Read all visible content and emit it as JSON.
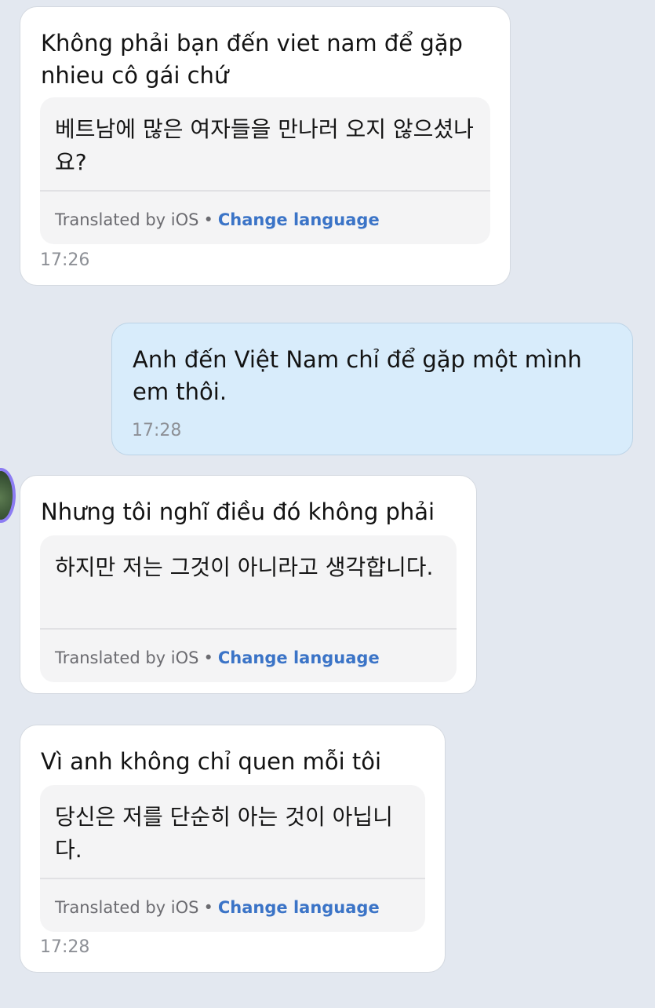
{
  "messages": [
    {
      "original": "Không phải bạn đến viet nam để gặp nhieu cô gái chứ",
      "translation": "베트남에 많은 여자들을 만나러 오지 않으셨나요?",
      "translated_by": "Translated by iOS",
      "separator": "•",
      "change_language": "Change language",
      "time": "17:26"
    },
    {
      "text": "Anh đến Việt Nam chỉ để gặp một mình em thôi.",
      "time": "17:28"
    },
    {
      "original": "Nhưng tôi nghĩ điều đó không phải",
      "translation": "하지만 저는 그것이 아니라고 생각합니다.",
      "translated_by": "Translated by iOS",
      "separator": "•",
      "change_language": "Change language"
    },
    {
      "original": "Vì anh không chỉ quen mỗi tôi",
      "translation": "당신은 저를 단순히 아는 것이 아닙니다.",
      "translated_by": "Translated by iOS",
      "separator": "•",
      "change_language": "Change language",
      "time": "17:28"
    }
  ],
  "colors": {
    "background": "#e3e8f0",
    "incoming_bubble": "#ffffff",
    "outgoing_bubble": "#d8ecfb",
    "link": "#3b74c7",
    "avatar_ring": "#8c7cf3"
  },
  "icons": {
    "avatar": "contact-avatar"
  }
}
